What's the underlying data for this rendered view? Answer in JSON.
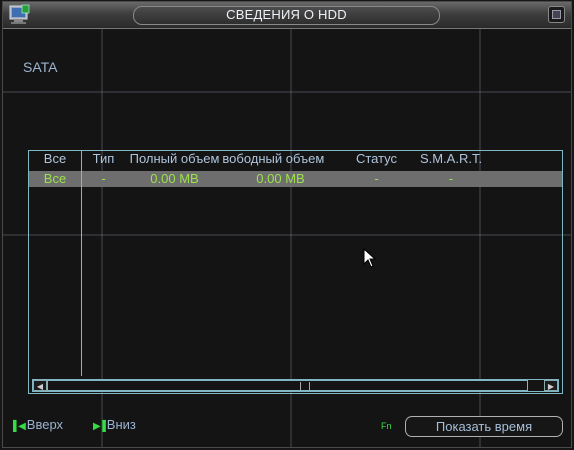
{
  "title": "СВЕДЕНИЯ О HDD",
  "section_label": "SATA",
  "table": {
    "headers": [
      "Все",
      "Тип",
      "Полный объем",
      "Свободный объем",
      "Статус",
      "S.M.A.R.T."
    ],
    "rows": [
      [
        "Все",
        "-",
        "0.00 MB",
        "0.00 MB",
        "-",
        "-"
      ]
    ]
  },
  "footer": {
    "prev_label": "Вверх",
    "next_label": "Вниз",
    "fn_label": "Fn",
    "show_time_label": "Показать время"
  },
  "colors": {
    "accent_green": "#9be24a",
    "border_cyan": "#7fb7c4",
    "selected_row": "#6e6e6e"
  }
}
